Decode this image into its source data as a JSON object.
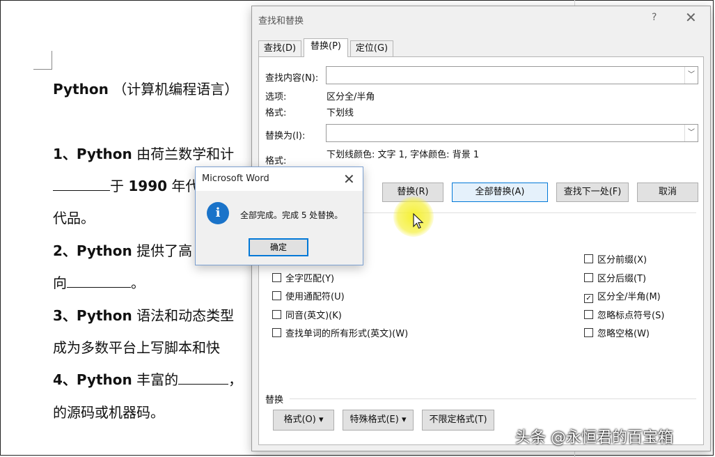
{
  "document": {
    "line1": {
      "bold": "Python",
      "text": " （计算机编程语言）"
    },
    "line2": {
      "num": "1、",
      "bold": "Python",
      "text": " 由荷兰数学和计"
    },
    "line3": {
      "text1": "于 ",
      "bold": "1990",
      "text2": " 年代"
    },
    "line4": {
      "text": "代品。"
    },
    "line5": {
      "num": "2、",
      "bold": "Python",
      "text": " 提供了高"
    },
    "line6": {
      "text1": "向",
      "text2": "。"
    },
    "line7": {
      "num": "3、",
      "bold": "Python",
      "text": " 语法和动态类型"
    },
    "line8": {
      "text": "成为多数平台上写脚本和快"
    },
    "line9": {
      "num": "4、",
      "bold": "Python",
      "text": " 丰富的",
      "text2": "，"
    },
    "line10": {
      "text": "的源码或机器码。"
    }
  },
  "dialog": {
    "title": "查找和替换",
    "help": "?",
    "close": "✕",
    "tabs": [
      {
        "label": "查找(D)"
      },
      {
        "label": "替换(P)"
      },
      {
        "label": "定位(G)"
      }
    ],
    "find_label": "查找内容(N):",
    "find_value": "",
    "options_label": "选项:",
    "options_value": "区分全/半角",
    "format_label": "格式:",
    "find_format_value": "下划线",
    "replace_label": "替换为(I):",
    "replace_value": "",
    "replace_format_label": "格式:",
    "replace_format_value": "下划线颜色: 文字 1, 字体颜色: 背景 1",
    "buttons": {
      "replace": "替换(R)",
      "replace_all": "全部替换(A)",
      "find_next": "查找下一处(F)",
      "cancel": "取消"
    },
    "checkboxes_left": [
      {
        "label": "全字匹配(Y)",
        "checked": false
      },
      {
        "label": "使用通配符(U)",
        "checked": false
      },
      {
        "label": "同音(英文)(K)",
        "checked": false
      },
      {
        "label": "查找单词的所有形式(英文)(W)",
        "checked": false
      }
    ],
    "checkboxes_right": [
      {
        "label": "区分前缀(X)",
        "checked": false
      },
      {
        "label": "区分后缀(T)",
        "checked": false
      },
      {
        "label": "区分全/半角(M)",
        "checked": true
      },
      {
        "label": "忽略标点符号(S)",
        "checked": false
      },
      {
        "label": "忽略空格(W)",
        "checked": false
      }
    ],
    "replace_section_label": "替换",
    "bottom_buttons": {
      "format": "格式(O) ▾",
      "special": "特殊格式(E) ▾",
      "no_format": "不限定格式(T)"
    }
  },
  "messagebox": {
    "title": "Microsoft Word",
    "close": "✕",
    "icon": "info-icon",
    "icon_glyph": "i",
    "text": "全部完成。完成 5 处替换。",
    "ok": "确定"
  },
  "watermark": "头条 @永恒君的百宝箱",
  "colors": {
    "accent": "#0078d7",
    "info_icon": "#1a73c9",
    "highlight": "#f5f028"
  }
}
